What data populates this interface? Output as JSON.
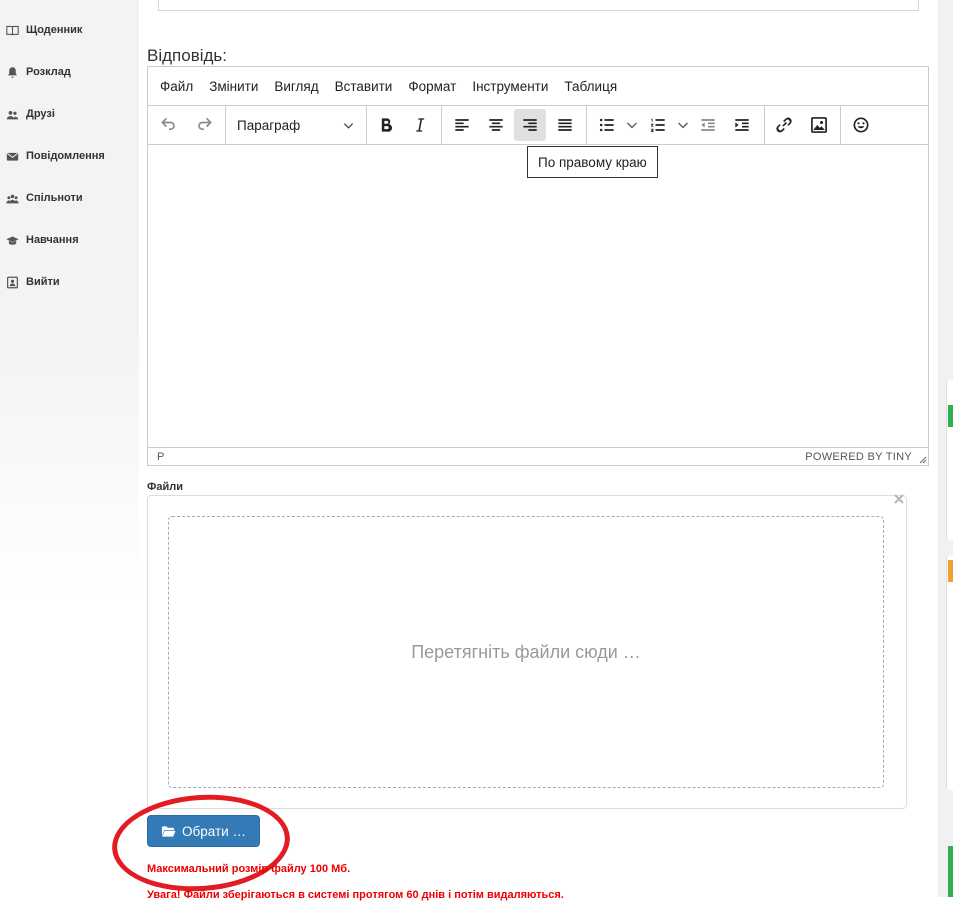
{
  "sidebar": {
    "items": [
      {
        "label": "Щоденник",
        "icon": "book-icon"
      },
      {
        "label": "Розклад",
        "icon": "bell-icon"
      },
      {
        "label": "Друзі",
        "icon": "users-icon"
      },
      {
        "label": "Повідомлення",
        "icon": "envelope-icon"
      },
      {
        "label": "Спільноти",
        "icon": "community-icon"
      },
      {
        "label": "Навчання",
        "icon": "graduation-cap-icon"
      },
      {
        "label": "Вийти",
        "icon": "logout-icon"
      }
    ]
  },
  "answer": {
    "label": "Відповідь:"
  },
  "editor": {
    "menu": [
      "Файл",
      "Змінити",
      "Вигляд",
      "Вставити",
      "Формат",
      "Інструменти",
      "Таблиця"
    ],
    "block_format": "Параграф",
    "tooltip": "По правому краю",
    "status_path": "P",
    "powered_by": "POWERED BY TINY"
  },
  "files": {
    "label": "Файли",
    "dropzone_text": "Перетягніть файли сюди …",
    "choose_button": "Обрати …",
    "max_size_note": "Максимальний розмір файлу 100 Мб.",
    "warning_note": "Увага! Файли зберігаються в системі протягом 60 днів і потім видаляються."
  },
  "colors": {
    "primary_button": "#337ab7",
    "annotation_red": "#e31b23",
    "warning_text": "#e00000",
    "sidebar_bg": "#f3f3f3"
  }
}
